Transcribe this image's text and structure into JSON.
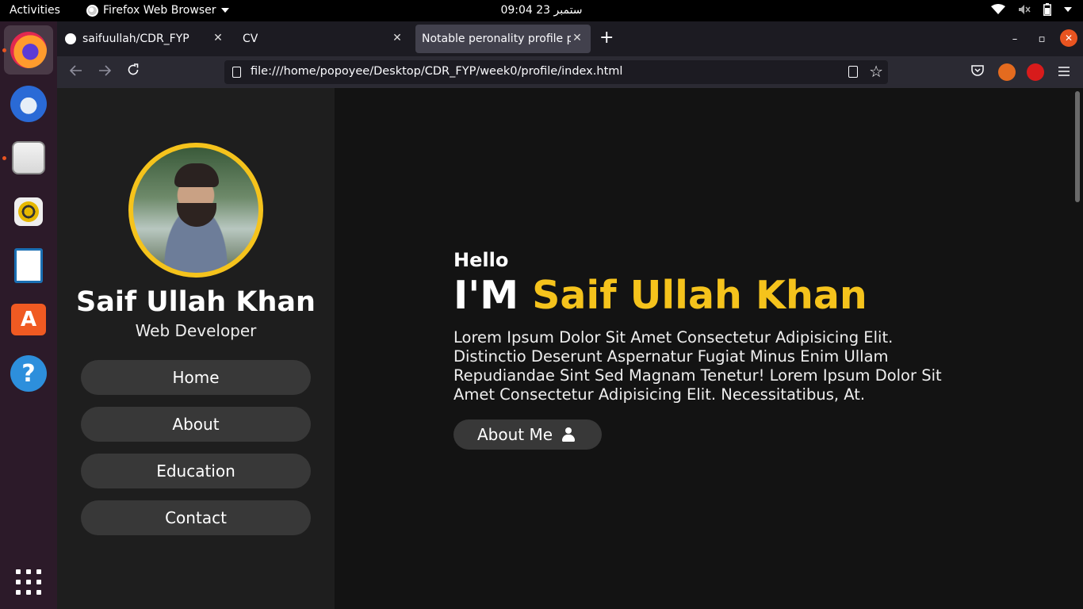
{
  "topbar": {
    "activities": "Activities",
    "app_name": "Firefox Web Browser",
    "clock": "09:04  23 ستمبر"
  },
  "dock": {
    "apps": [
      "firefox-icon",
      "thunderbird-icon",
      "files-icon",
      "rhythmbox-icon",
      "libreoffice-writer-icon",
      "software-center-icon",
      "help-icon",
      "show-applications-icon"
    ],
    "store_glyph": "A",
    "help_glyph": "?"
  },
  "browser": {
    "tabs": [
      {
        "title": "saifuullah/CDR_FYP",
        "selected": false
      },
      {
        "title": "CV",
        "selected": false
      },
      {
        "title": "Notable peronality profile pa",
        "selected": true
      }
    ],
    "tab_close": "✕",
    "new_tab": "+",
    "url": "file:///home/popoyee/Desktop/CDR_FYP/week0/profile/index.html",
    "window_close": "✕",
    "window_minimize": "–",
    "window_restore": "▫"
  },
  "page": {
    "profile": {
      "name": "Saif Ullah Khan",
      "role": "Web Developer"
    },
    "nav": [
      "Home",
      "About",
      "Education",
      "Contact"
    ],
    "hero": {
      "greeting": "Hello",
      "intro": "I'M ",
      "name": "Saif Ullah Khan",
      "description": "Lorem Ipsum Dolor Sit Amet Consectetur Adipisicing Elit. Distinctio Deserunt Aspernatur Fugiat Minus Enim Ullam Repudiandae Sint Sed Magnam Tenetur! Lorem Ipsum Dolor Sit Amet Consectetur Adipisicing Elit. Necessitatibus, At.",
      "button": "About Me"
    },
    "colors": {
      "accent": "#f5c31c",
      "sidebar_bg": "#1e1e1e",
      "main_bg": "#131313",
      "pill_bg": "#383838"
    }
  }
}
